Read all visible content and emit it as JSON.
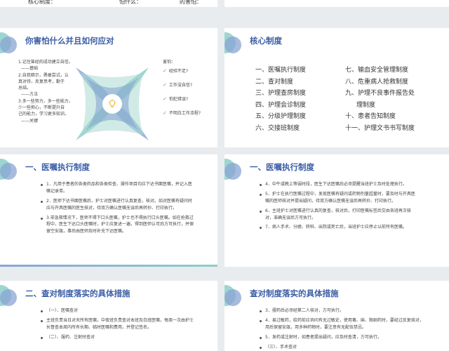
{
  "top_strip": [
    "核心制度：",
    "怕什么：",
    "的害怕："
  ],
  "slide1": {
    "title": "你害怕什么并且如何应对",
    "left_text": [
      "1.记住曾经的成功建立自信。",
      "——基础",
      "2.自我暗示，勇敢尝试，认",
      "真对待，反复思考，勤于",
      "总结。",
      "——方法",
      "3.多一些努力，多一些能力，",
      "少一些担心，不断提升自",
      "己的能力，学习更多知识。",
      "——关键"
    ],
    "fear_label": "害怕：",
    "fears": [
      "经验不足?",
      "工作没自信?",
      "怕犯错误?",
      "不明白工作流程?"
    ]
  },
  "slide2": {
    "title": "核心制度",
    "col1": [
      "一、医嘱执行制度",
      "二、查对制度",
      "三、护理查房制度",
      "四、护理会诊制度",
      "五、分级护理制度",
      "六、交接班制度"
    ],
    "col2": [
      "七、输血安全管理制度",
      "八、危重病人抢救制度",
      "九、护理不良事件报告处",
      "理制度",
      "十、患者告知制度",
      "十一、护理文书书写制度"
    ]
  },
  "slide3": {
    "title": "一、医嘱执行制度",
    "items": [
      "1．凡用于患者的各类药品和各类检查、操作项目均应下达书面医嘱，并记入医嘱记录单。",
      "2．医师下达书面医嘱后，护士对医嘱进行认真复查，核对。如对医嘱有疑问时应与开具医嘱的医生核对，待双方确认医嘱无误后再转抄、打印执行。",
      "3.非急救情况下，医师不得下口头医嘱，护士也不得执行口头医嘱。如在抢救过程中，医生下达口头医嘱时，护士应复述一遍，得到医师认可后方可执行，并保留空安瓿，事后由医师及时补充下达医嘱。"
    ]
  },
  "slide4": {
    "title": "一、医嘱执行制度",
    "items": [
      "4．中午或晚上等弱时段，医生下达医嘱后必须提醒当班护士及时处理执行。",
      "5．护士在执行医嘱过程中，发现医嘱有疑问或药物剂量超量时，要及时与开具医嘱的医师核对并提出疑问，待双方确认医嘱无误后再转抄、打印执行。",
      "6．主班护士对医嘱进行认真的复查，核对后，打印医嘱标签后交由各班再次核对，准确无误后方可执行。",
      "7．病人手术、分娩、转科、出院或死亡后，当班护士应停止以前所有医嘱。"
    ]
  },
  "slide5": {
    "title": "二、查对制度落实的具体措施",
    "items": [
      "（一）、医嘱查对",
      "主班负责当日对天所有医嘱，中夜班负责查对本班及白班医嘱，每周一次由护士长督查本周内所有长期、临时医嘱和费用，并登记签名。",
      "（二）、服药、注射时查对"
    ]
  },
  "slide6": {
    "title": "查对制度落实的具体措施",
    "items": [
      "3．摆药后必须经第二人核对，方可执行。",
      "4．易过敏药，给药前应询问有无过敏史，使用毒、麻、限剧药时，要经过反复核对，用后保留安瓿，用多种药物时，要注意有无配伍禁忌。",
      "5．发药或注射时，如患者提出疑问，应及时查清，方可执行。",
      "（三）、手术查对"
    ]
  },
  "colors": {
    "accent_blue": "#3b5ea6",
    "teal": "#8ccfc8",
    "periwinkle": "#8aa4d4",
    "background": "#e9ecef"
  }
}
